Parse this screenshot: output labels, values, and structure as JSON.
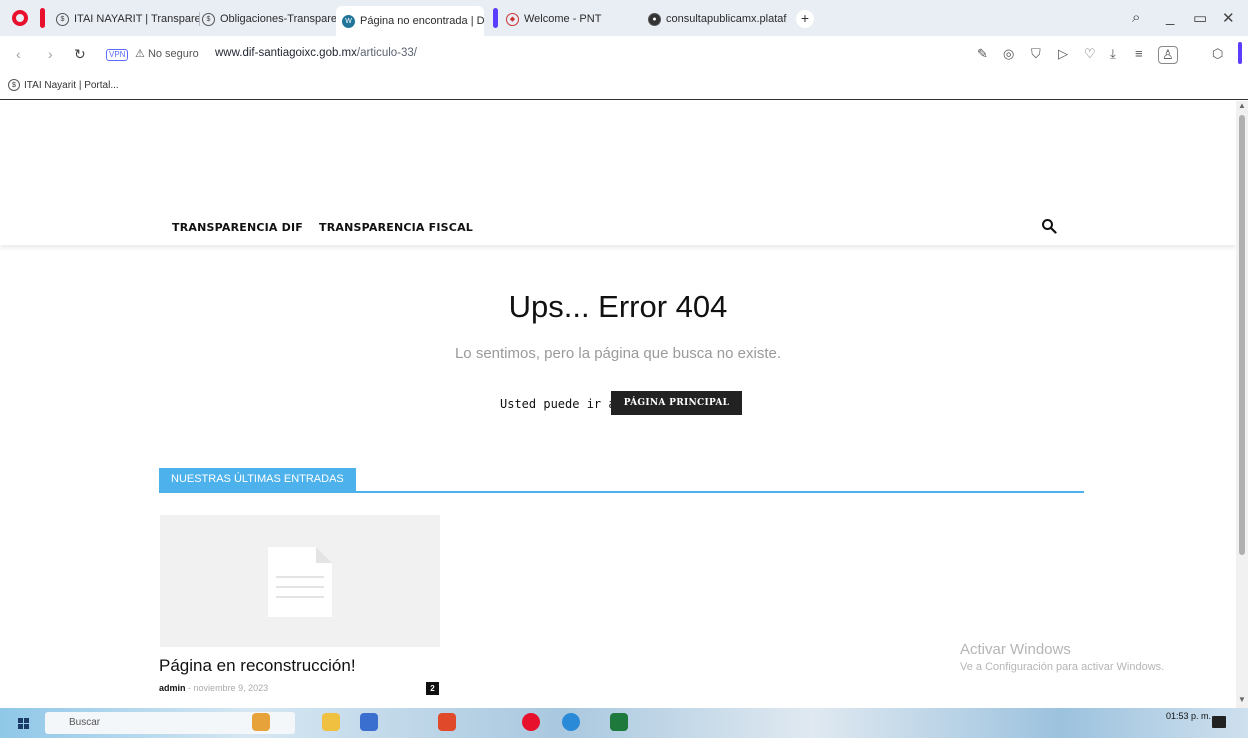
{
  "browser": {
    "tabs": [
      {
        "title": "ITAI NAYARIT | Transparen",
        "icon": "itai-favicon-icon"
      },
      {
        "title": "Obligaciones-Transparenc",
        "icon": "itai-favicon-icon"
      },
      {
        "title": "Página no encontrada | DI",
        "icon": "wordpress-icon",
        "active": true
      },
      {
        "title": "Welcome - PNT",
        "icon": "pnt-icon"
      },
      {
        "title": "consultapublicamx.platafo",
        "icon": "globe-icon"
      }
    ],
    "new_tab": "+",
    "address": {
      "vpn": "VPN",
      "security": "No seguro",
      "url_host": "www.dif-santiagoixc.gob.mx",
      "url_path": "/articulo-33/"
    },
    "bookmarks": [
      {
        "label": "ITAI Nayarit | Portal..."
      }
    ],
    "colors": {
      "accent": "#5a3dff",
      "opera_red": "#e8112d"
    }
  },
  "site": {
    "menu": [
      "TRANSPARENCIA DIF",
      "TRANSPARENCIA FISCAL"
    ],
    "error_title": "Ups... Error 404",
    "error_subtitle": "Lo sentimos, pero la página que busca no existe.",
    "go_to_text": "Usted puede ir a",
    "home_button": "PÁGINA PRINCIPAL",
    "latest_heading": "NUESTRAS ÚLTIMAS ENTRADAS",
    "post": {
      "title": "Página en reconstrucción!",
      "author": "admin",
      "separator": "-",
      "date": "noviembre 9, 2023",
      "comments": "2"
    },
    "colors": {
      "block_blue": "#4db2ec",
      "dark": "#222222"
    }
  },
  "watermark": {
    "line1": "Activar Windows",
    "line2": "Ve a Configuración para activar Windows."
  },
  "taskbar": {
    "search_placeholder": "Buscar",
    "time": "01:53 p. m."
  }
}
